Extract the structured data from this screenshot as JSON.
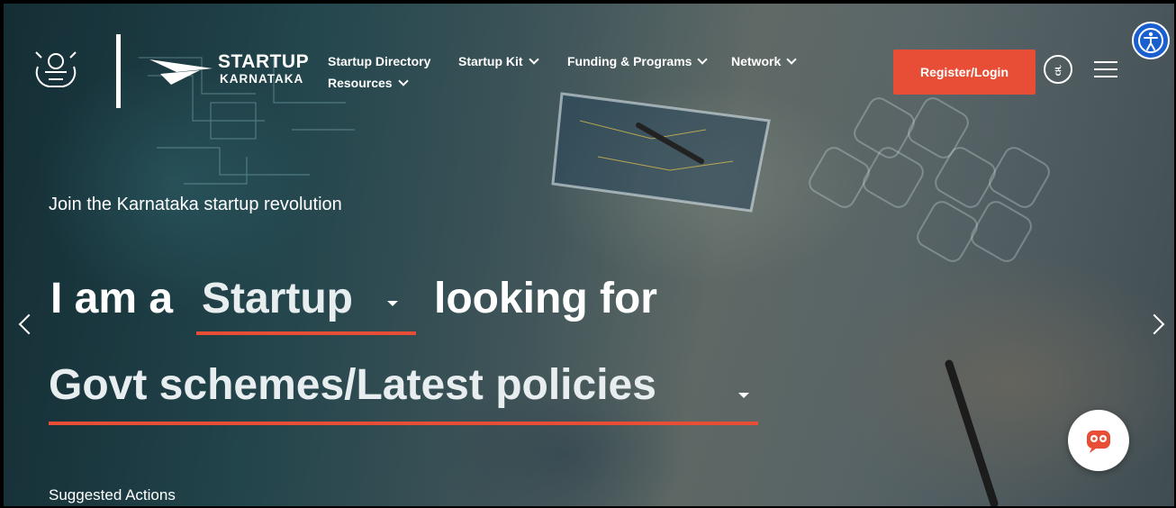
{
  "brand": {
    "title": "STARTUP",
    "subtitle": "KARNATAKA"
  },
  "nav": {
    "items": [
      {
        "label": "Startup Directory",
        "dropdown": false
      },
      {
        "label": "Startup Kit",
        "dropdown": true
      },
      {
        "label": "Funding & Programs",
        "dropdown": true
      },
      {
        "label": "Network",
        "dropdown": true
      },
      {
        "label": "Resources",
        "dropdown": true
      }
    ],
    "register_label": "Register/Login",
    "language_glyph": "ಕ"
  },
  "hero": {
    "tagline": "Join the Karnataka startup revolution",
    "prefix": "I am a",
    "role_selected": "Startup",
    "middle": "looking for",
    "need_selected": "Govt schemes/Latest policies"
  },
  "footer": {
    "suggested_label": "Suggested Actions"
  },
  "colors": {
    "accent": "#e84e36",
    "accessibility": "#1a5fd0"
  },
  "icons": [
    "karnataka-emblem-icon",
    "startup-karnataka-logo-icon",
    "chevron-down-icon",
    "language-icon",
    "hamburger-menu-icon",
    "accessibility-icon",
    "chevron-left-icon",
    "chevron-right-icon",
    "chatbot-icon"
  ]
}
